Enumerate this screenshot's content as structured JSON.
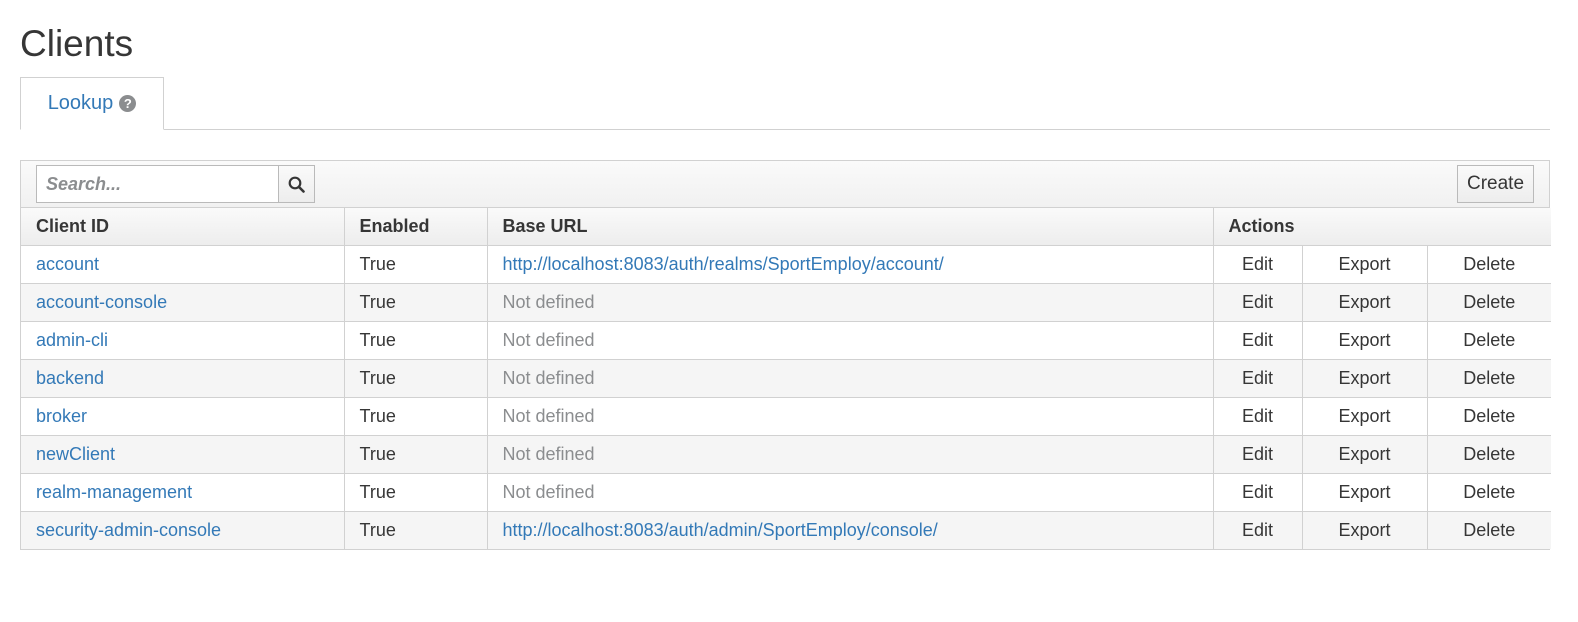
{
  "page": {
    "title": "Clients"
  },
  "tabs": [
    {
      "label": "Lookup"
    }
  ],
  "toolbar": {
    "search_placeholder": "Search...",
    "create_label": "Create"
  },
  "table": {
    "headers": {
      "client_id": "Client ID",
      "enabled": "Enabled",
      "base_url": "Base URL",
      "actions": "Actions"
    },
    "action_labels": {
      "edit": "Edit",
      "export": "Export",
      "delete": "Delete"
    },
    "rows": [
      {
        "client_id": "account",
        "enabled": "True",
        "base_url": "http://localhost:8083/auth/realms/SportEmploy/account/",
        "base_url_defined": true
      },
      {
        "client_id": "account-console",
        "enabled": "True",
        "base_url": "Not defined",
        "base_url_defined": false
      },
      {
        "client_id": "admin-cli",
        "enabled": "True",
        "base_url": "Not defined",
        "base_url_defined": false
      },
      {
        "client_id": "backend",
        "enabled": "True",
        "base_url": "Not defined",
        "base_url_defined": false
      },
      {
        "client_id": "broker",
        "enabled": "True",
        "base_url": "Not defined",
        "base_url_defined": false
      },
      {
        "client_id": "newClient",
        "enabled": "True",
        "base_url": "Not defined",
        "base_url_defined": false
      },
      {
        "client_id": "realm-management",
        "enabled": "True",
        "base_url": "Not defined",
        "base_url_defined": false
      },
      {
        "client_id": "security-admin-console",
        "enabled": "True",
        "base_url": "http://localhost:8083/auth/admin/SportEmploy/console/",
        "base_url_defined": true
      }
    ]
  },
  "icons": {
    "search": "search-icon",
    "help": "question-circle-icon"
  },
  "colors": {
    "link": "#3379b7",
    "muted": "#8b8d8f",
    "border": "#d1d1d1"
  }
}
